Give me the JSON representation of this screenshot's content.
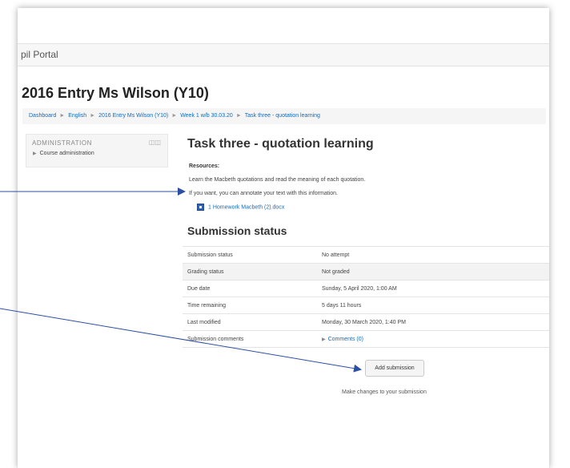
{
  "header": {
    "portal_title": "pil Portal"
  },
  "course": {
    "title": "2016 Entry Ms Wilson (Y10)"
  },
  "breadcrumb": [
    "Dashboard",
    "English",
    "2016 Entry Ms Wilson (Y10)",
    "Week 1 w/b 30.03.20",
    "Task three - quotation learning"
  ],
  "admin_block": {
    "title": "ADMINISTRATION",
    "item": "Course administration"
  },
  "assignment": {
    "title": "Task three - quotation learning",
    "resources_heading": "Resources:",
    "intro_line1": "Learn the Macbeth quotations and read the meaning of each quotation.",
    "intro_line2": "If you want, you can annotate your text with this information.",
    "file_name": "1 Homework Macbeth (2).docx"
  },
  "submission": {
    "heading": "Submission status",
    "rows": [
      {
        "label": "Submission status",
        "value": "No attempt"
      },
      {
        "label": "Grading status",
        "value": "Not graded"
      },
      {
        "label": "Due date",
        "value": "Sunday, 5 April 2020, 1:00 AM"
      },
      {
        "label": "Time remaining",
        "value": "5 days 11 hours"
      },
      {
        "label": "Last modified",
        "value": "Monday, 30 March 2020, 1:40 PM"
      },
      {
        "label": "Submission comments",
        "value": "Comments (0)"
      }
    ],
    "add_button": "Add submission",
    "help_text": "Make changes to your submission"
  },
  "colors": {
    "link": "#0f6cbf",
    "annotation_arrow": "#2d4fa3",
    "file_icon": "#2f62b4"
  },
  "icons": {
    "file": "word-doc-icon",
    "expand": "caret-right-icon",
    "block_controls": "block-controls-icon"
  }
}
